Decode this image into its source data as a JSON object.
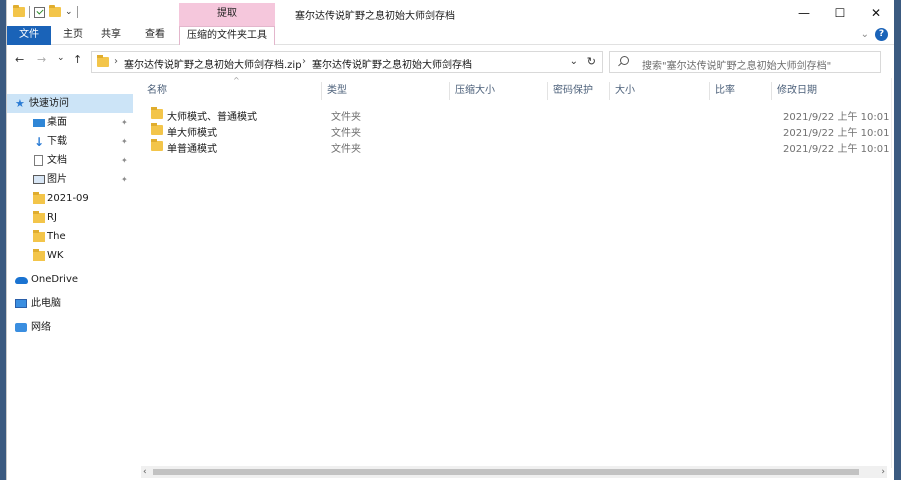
{
  "title_bar": {
    "context_tab_header": "提取",
    "window_title": "塞尔达传说旷野之息初始大师剑存档",
    "controls": {
      "minimize": "—",
      "maximize": "☐",
      "close": "✕"
    }
  },
  "ribbon": {
    "tabs": [
      "文件",
      "主页",
      "共享",
      "查看",
      "压缩的文件夹工具"
    ],
    "collapse_glyph": "⌄",
    "help_glyph": "?"
  },
  "address_bar": {
    "back": "←",
    "forward": "→",
    "recent": "⌄",
    "up": "↑",
    "breadcrumb_separator": "›",
    "crumbs": [
      "塞尔达传说旷野之息初始大师剑存档.zip",
      "塞尔达传说旷野之息初始大师剑存档"
    ],
    "dropdown_glyph": "⌄",
    "refresh_glyph": "↻"
  },
  "search": {
    "placeholder": "搜索\"塞尔达传说旷野之息初始大师剑存档\""
  },
  "nav_pane": {
    "quick_access": "快速访问",
    "pin_glyph": "📌",
    "items": [
      {
        "label": "桌面",
        "icon": "desktop-icon",
        "pinned": true
      },
      {
        "label": "下载",
        "icon": "download-icon",
        "pinned": true
      },
      {
        "label": "文档",
        "icon": "document-icon",
        "pinned": true
      },
      {
        "label": "图片",
        "icon": "pictures-icon",
        "pinned": true
      },
      {
        "label": "2021-09",
        "icon": "folder-icon",
        "pinned": false
      },
      {
        "label": "RJ",
        "icon": "folder-icon",
        "pinned": false
      },
      {
        "label": "The",
        "icon": "folder-icon",
        "pinned": false
      },
      {
        "label": "WK",
        "icon": "folder-icon",
        "pinned": false
      }
    ],
    "onedrive": "OneDrive",
    "this_pc": "此电脑",
    "network": "网络"
  },
  "columns": [
    "名称",
    "类型",
    "压缩大小",
    "密码保护",
    "大小",
    "比率",
    "修改日期"
  ],
  "sort_indicator": "^",
  "files": [
    {
      "name": "大师模式、普通模式",
      "type": "文件夹",
      "modified": "2021/9/22 上午 10:01"
    },
    {
      "name": "单大师模式",
      "type": "文件夹",
      "modified": "2021/9/22 上午 10:01"
    },
    {
      "name": "单普通模式",
      "type": "文件夹",
      "modified": "2021/9/22 上午 10:01"
    }
  ],
  "scrollbar": {
    "left": "‹",
    "right": "›"
  }
}
